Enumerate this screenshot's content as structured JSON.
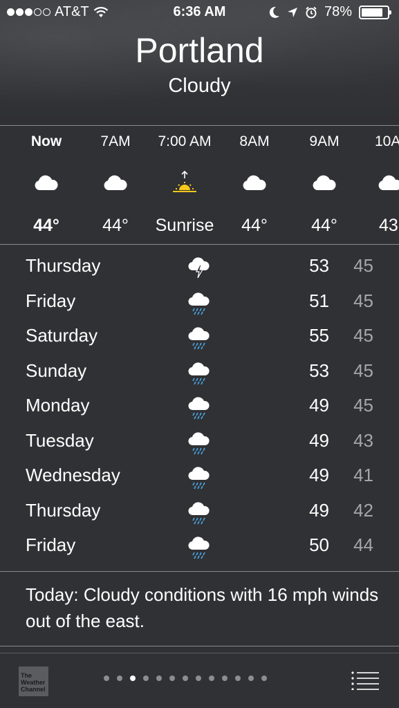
{
  "status_bar": {
    "carrier": "AT&T",
    "time": "6:36 AM",
    "battery": "78%",
    "battery_level": 0.78,
    "signal_bars": 3
  },
  "location": {
    "city": "Portland",
    "condition": "Cloudy"
  },
  "hourly": [
    {
      "time": "Now",
      "icon": "cloud-icon",
      "value": "44°"
    },
    {
      "time": "7AM",
      "icon": "cloud-icon",
      "value": "44°"
    },
    {
      "time": "7:00 AM",
      "icon": "sunrise-icon",
      "value": "Sunrise"
    },
    {
      "time": "8AM",
      "icon": "cloud-icon",
      "value": "44°"
    },
    {
      "time": "9AM",
      "icon": "cloud-icon",
      "value": "44°"
    },
    {
      "time": "10A",
      "icon": "cloud-icon",
      "value": "43"
    }
  ],
  "daily": [
    {
      "day": "Thursday",
      "icon": "thunderstorm-icon",
      "high": "53",
      "low": "45"
    },
    {
      "day": "Friday",
      "icon": "rain-icon",
      "high": "51",
      "low": "45"
    },
    {
      "day": "Saturday",
      "icon": "rain-icon",
      "high": "55",
      "low": "45"
    },
    {
      "day": "Sunday",
      "icon": "rain-icon",
      "high": "53",
      "low": "45"
    },
    {
      "day": "Monday",
      "icon": "rain-icon",
      "high": "49",
      "low": "45"
    },
    {
      "day": "Tuesday",
      "icon": "rain-icon",
      "high": "49",
      "low": "43"
    },
    {
      "day": "Wednesday",
      "icon": "rain-icon",
      "high": "49",
      "low": "41"
    },
    {
      "day": "Thursday",
      "icon": "rain-icon",
      "high": "49",
      "low": "42"
    },
    {
      "day": "Friday",
      "icon": "rain-icon",
      "high": "50",
      "low": "44"
    }
  ],
  "summary": "Today: Cloudy conditions with 16 mph winds out of the east.",
  "footer": {
    "logo_text": "The Weather Channel",
    "page_count": 13,
    "current_page": 3
  },
  "colors": {
    "background": "#303134",
    "rain": "#4aa8e8",
    "sun": "#f8c81c"
  }
}
